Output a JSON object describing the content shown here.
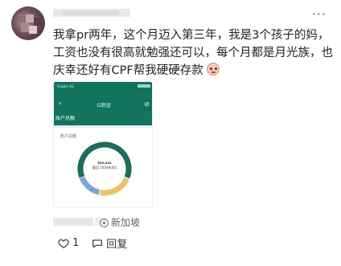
{
  "post": {
    "more_icon": "more-horizontal-icon",
    "text_lines": [
      "我拿pr两年，这个月迈入第三年，我是3个孩子的妈，",
      "工资也没有很高就勉强还可以，每个月都是月光族，也",
      "庆幸还好有CPF帮我硬硬存款"
    ],
    "emoji": "crying-face-emoji"
  },
  "phone_screenshot": {
    "status_left": "Singtel 4G",
    "title": "公积金",
    "balance_tab": "账户总额",
    "section_label": "账户总额",
    "center_lines": [
      "$xx,xxx",
      "截至 2024年4月"
    ],
    "colors": {
      "header": "#12735e",
      "ring_main": "#1f6b5c",
      "ring_yellow": "#e9c46a",
      "ring_blue": "#7aa6d8"
    }
  },
  "chart_data": {
    "type": "pie",
    "title": "",
    "series": [
      {
        "name": "",
        "values": [
          0.62,
          0.22,
          0.16
        ]
      }
    ],
    "colors": [
      "#1f6b5c",
      "#e9c46a",
      "#7aa6d8"
    ],
    "style": "donut"
  },
  "footer": {
    "location_icon": "location-pin-icon",
    "location": "新加坡",
    "like_icon": "heart-icon",
    "like_count": "1",
    "comment_icon": "comment-icon",
    "reply_label": "回复"
  }
}
